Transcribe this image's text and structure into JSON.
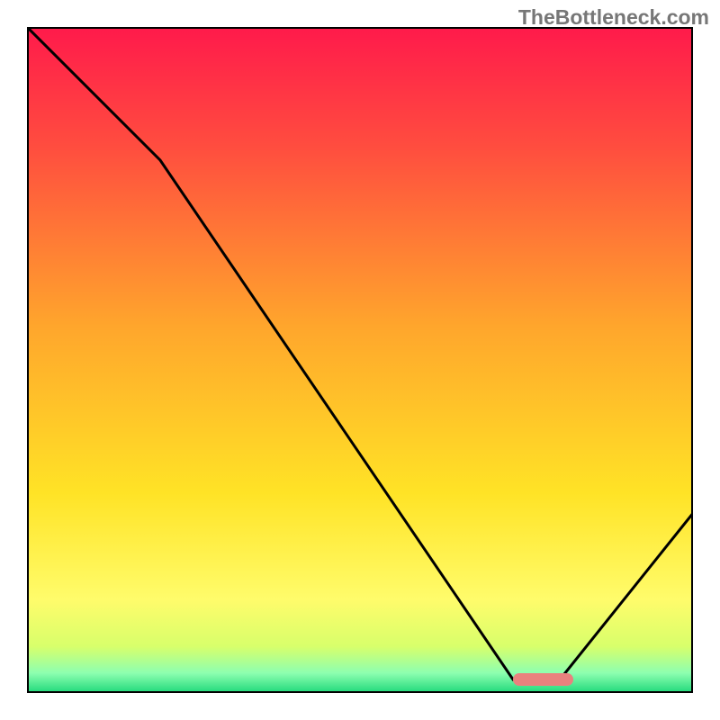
{
  "watermark": "TheBottleneck.com",
  "chart_data": {
    "type": "line",
    "title": "",
    "xlabel": "",
    "ylabel": "",
    "xlim": [
      0,
      100
    ],
    "ylim": [
      0,
      100
    ],
    "x": [
      0,
      3,
      20,
      73,
      80,
      100
    ],
    "values": [
      100,
      97,
      80,
      2,
      2,
      27
    ],
    "marker": {
      "x_start": 73,
      "x_end": 82,
      "y": 2
    },
    "background_gradient": {
      "stops": [
        {
          "offset": 0.0,
          "color": "#ff1a4b"
        },
        {
          "offset": 0.18,
          "color": "#ff4d3f"
        },
        {
          "offset": 0.45,
          "color": "#ffa62c"
        },
        {
          "offset": 0.7,
          "color": "#ffe326"
        },
        {
          "offset": 0.86,
          "color": "#fffc6b"
        },
        {
          "offset": 0.93,
          "color": "#d8ff6b"
        },
        {
          "offset": 0.97,
          "color": "#8dffb0"
        },
        {
          "offset": 1.0,
          "color": "#1fd87a"
        }
      ]
    }
  }
}
